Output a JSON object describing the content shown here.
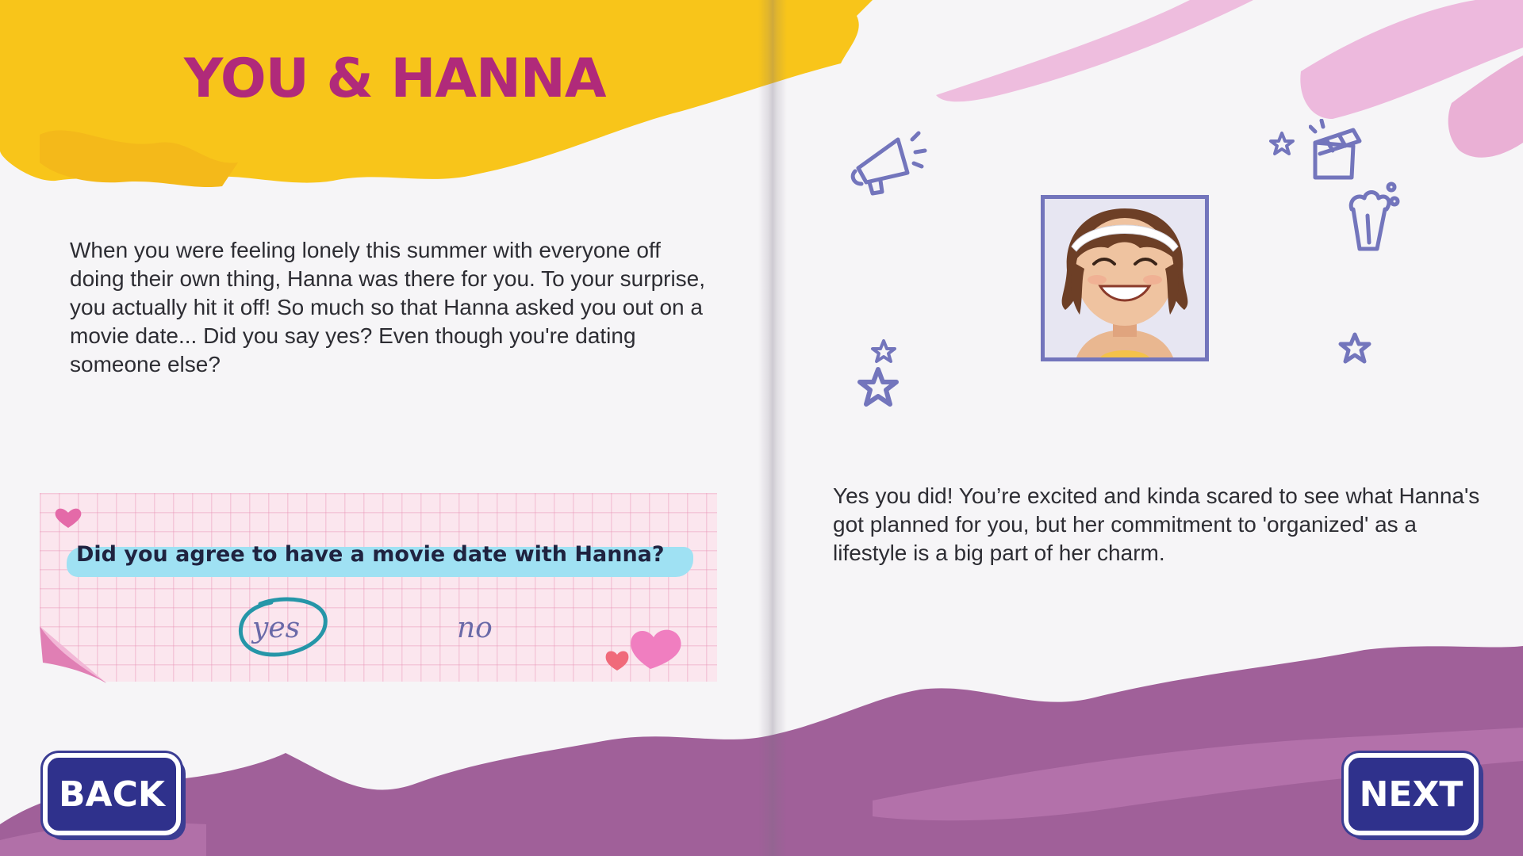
{
  "page": {
    "title": "YOU & HANNA",
    "story_text": "When you were feeling lonely this summer with everyone off doing their own thing, Hanna was there for you. To your surprise, you actually hit it off! So much so that Hanna asked you out on a movie date... Did you say yes?  Even though you're dating someone else?",
    "result_text": "Yes you did! You’re excited and kinda scared to see what Hanna's got planned for you, but her commitment to 'organized' as a lifestyle is a big part of her charm."
  },
  "note": {
    "question": "Did you agree to have a movie date with Hanna?",
    "options": [
      {
        "label": "yes",
        "selected": true
      },
      {
        "label": "no",
        "selected": false
      }
    ]
  },
  "nav": {
    "back_label": "BACK",
    "next_label": "NEXT"
  },
  "icons": [
    "megaphone-icon",
    "clapperboard-icon",
    "popcorn-icon",
    "star-icon",
    "heart-icon"
  ],
  "colors": {
    "title": "#b02a7a",
    "yellow_brush": "#f8c51a",
    "purple_brush": "#a06099",
    "pink_brush": "#ecb3d9",
    "button": "#2f318c",
    "doodle": "#7375bc",
    "highlight": "#9fe1f3"
  }
}
